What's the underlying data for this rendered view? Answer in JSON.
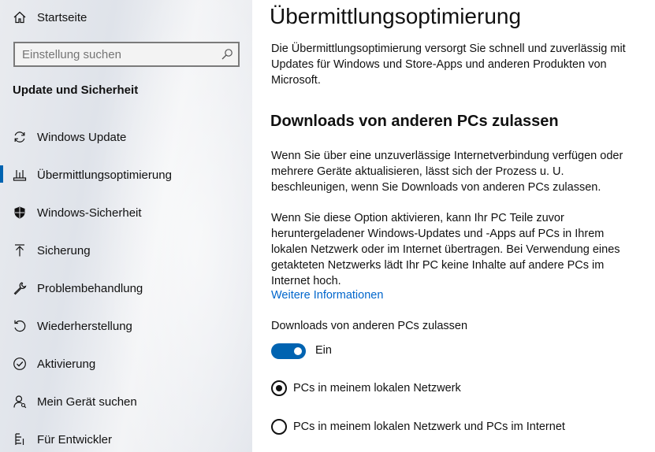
{
  "sidebar": {
    "home_label": "Startseite",
    "search": {
      "placeholder": "Einstellung suchen"
    },
    "section_title": "Update und Sicherheit",
    "items": [
      {
        "label": "Windows Update",
        "icon": "sync-icon"
      },
      {
        "label": "Übermittlungsoptimierung",
        "icon": "delivery-optimization-icon",
        "selected": true
      },
      {
        "label": "Windows-Sicherheit",
        "icon": "shield-icon"
      },
      {
        "label": "Sicherung",
        "icon": "backup-arrow-icon"
      },
      {
        "label": "Problembehandlung",
        "icon": "wrench-icon"
      },
      {
        "label": "Wiederherstellung",
        "icon": "recovery-icon"
      },
      {
        "label": "Aktivierung",
        "icon": "check-circle-icon"
      },
      {
        "label": "Mein Gerät suchen",
        "icon": "person-locate-icon"
      },
      {
        "label": "Für Entwickler",
        "icon": "developer-icon"
      }
    ]
  },
  "main": {
    "title": "Übermittlungsoptimierung",
    "intro": "Die Übermittlungsoptimierung versorgt Sie schnell und zuverlässig mit Updates für Windows und Store-Apps und anderen Produkten von Microsoft.",
    "subheading": "Downloads von anderen PCs zulassen",
    "para1": "Wenn Sie über eine unzuverlässige Internetverbindung verfügen oder mehrere Geräte aktualisieren, lässt sich der Prozess u. U. beschleunigen, wenn Sie Downloads von anderen PCs zulassen.",
    "para2": "Wenn Sie diese Option aktivieren, kann Ihr PC Teile zuvor heruntergeladener Windows-Updates und -Apps auf PCs in Ihrem lokalen Netzwerk oder im Internet übertragen. Bei Verwendung eines getakteten Netzwerks lädt Ihr PC keine Inhalte auf andere PCs im Internet hoch.",
    "more_link": "Weitere Informationen",
    "toggle_label": "Downloads von anderen PCs zulassen",
    "toggle_state": "Ein",
    "toggle_on": true,
    "radio_local": "PCs in meinem lokalen Netzwerk",
    "radio_internet": "PCs in meinem lokalen Netzwerk und PCs im Internet",
    "selected_radio": "local"
  },
  "colors": {
    "accent": "#0063b1",
    "link": "#0066cc"
  }
}
